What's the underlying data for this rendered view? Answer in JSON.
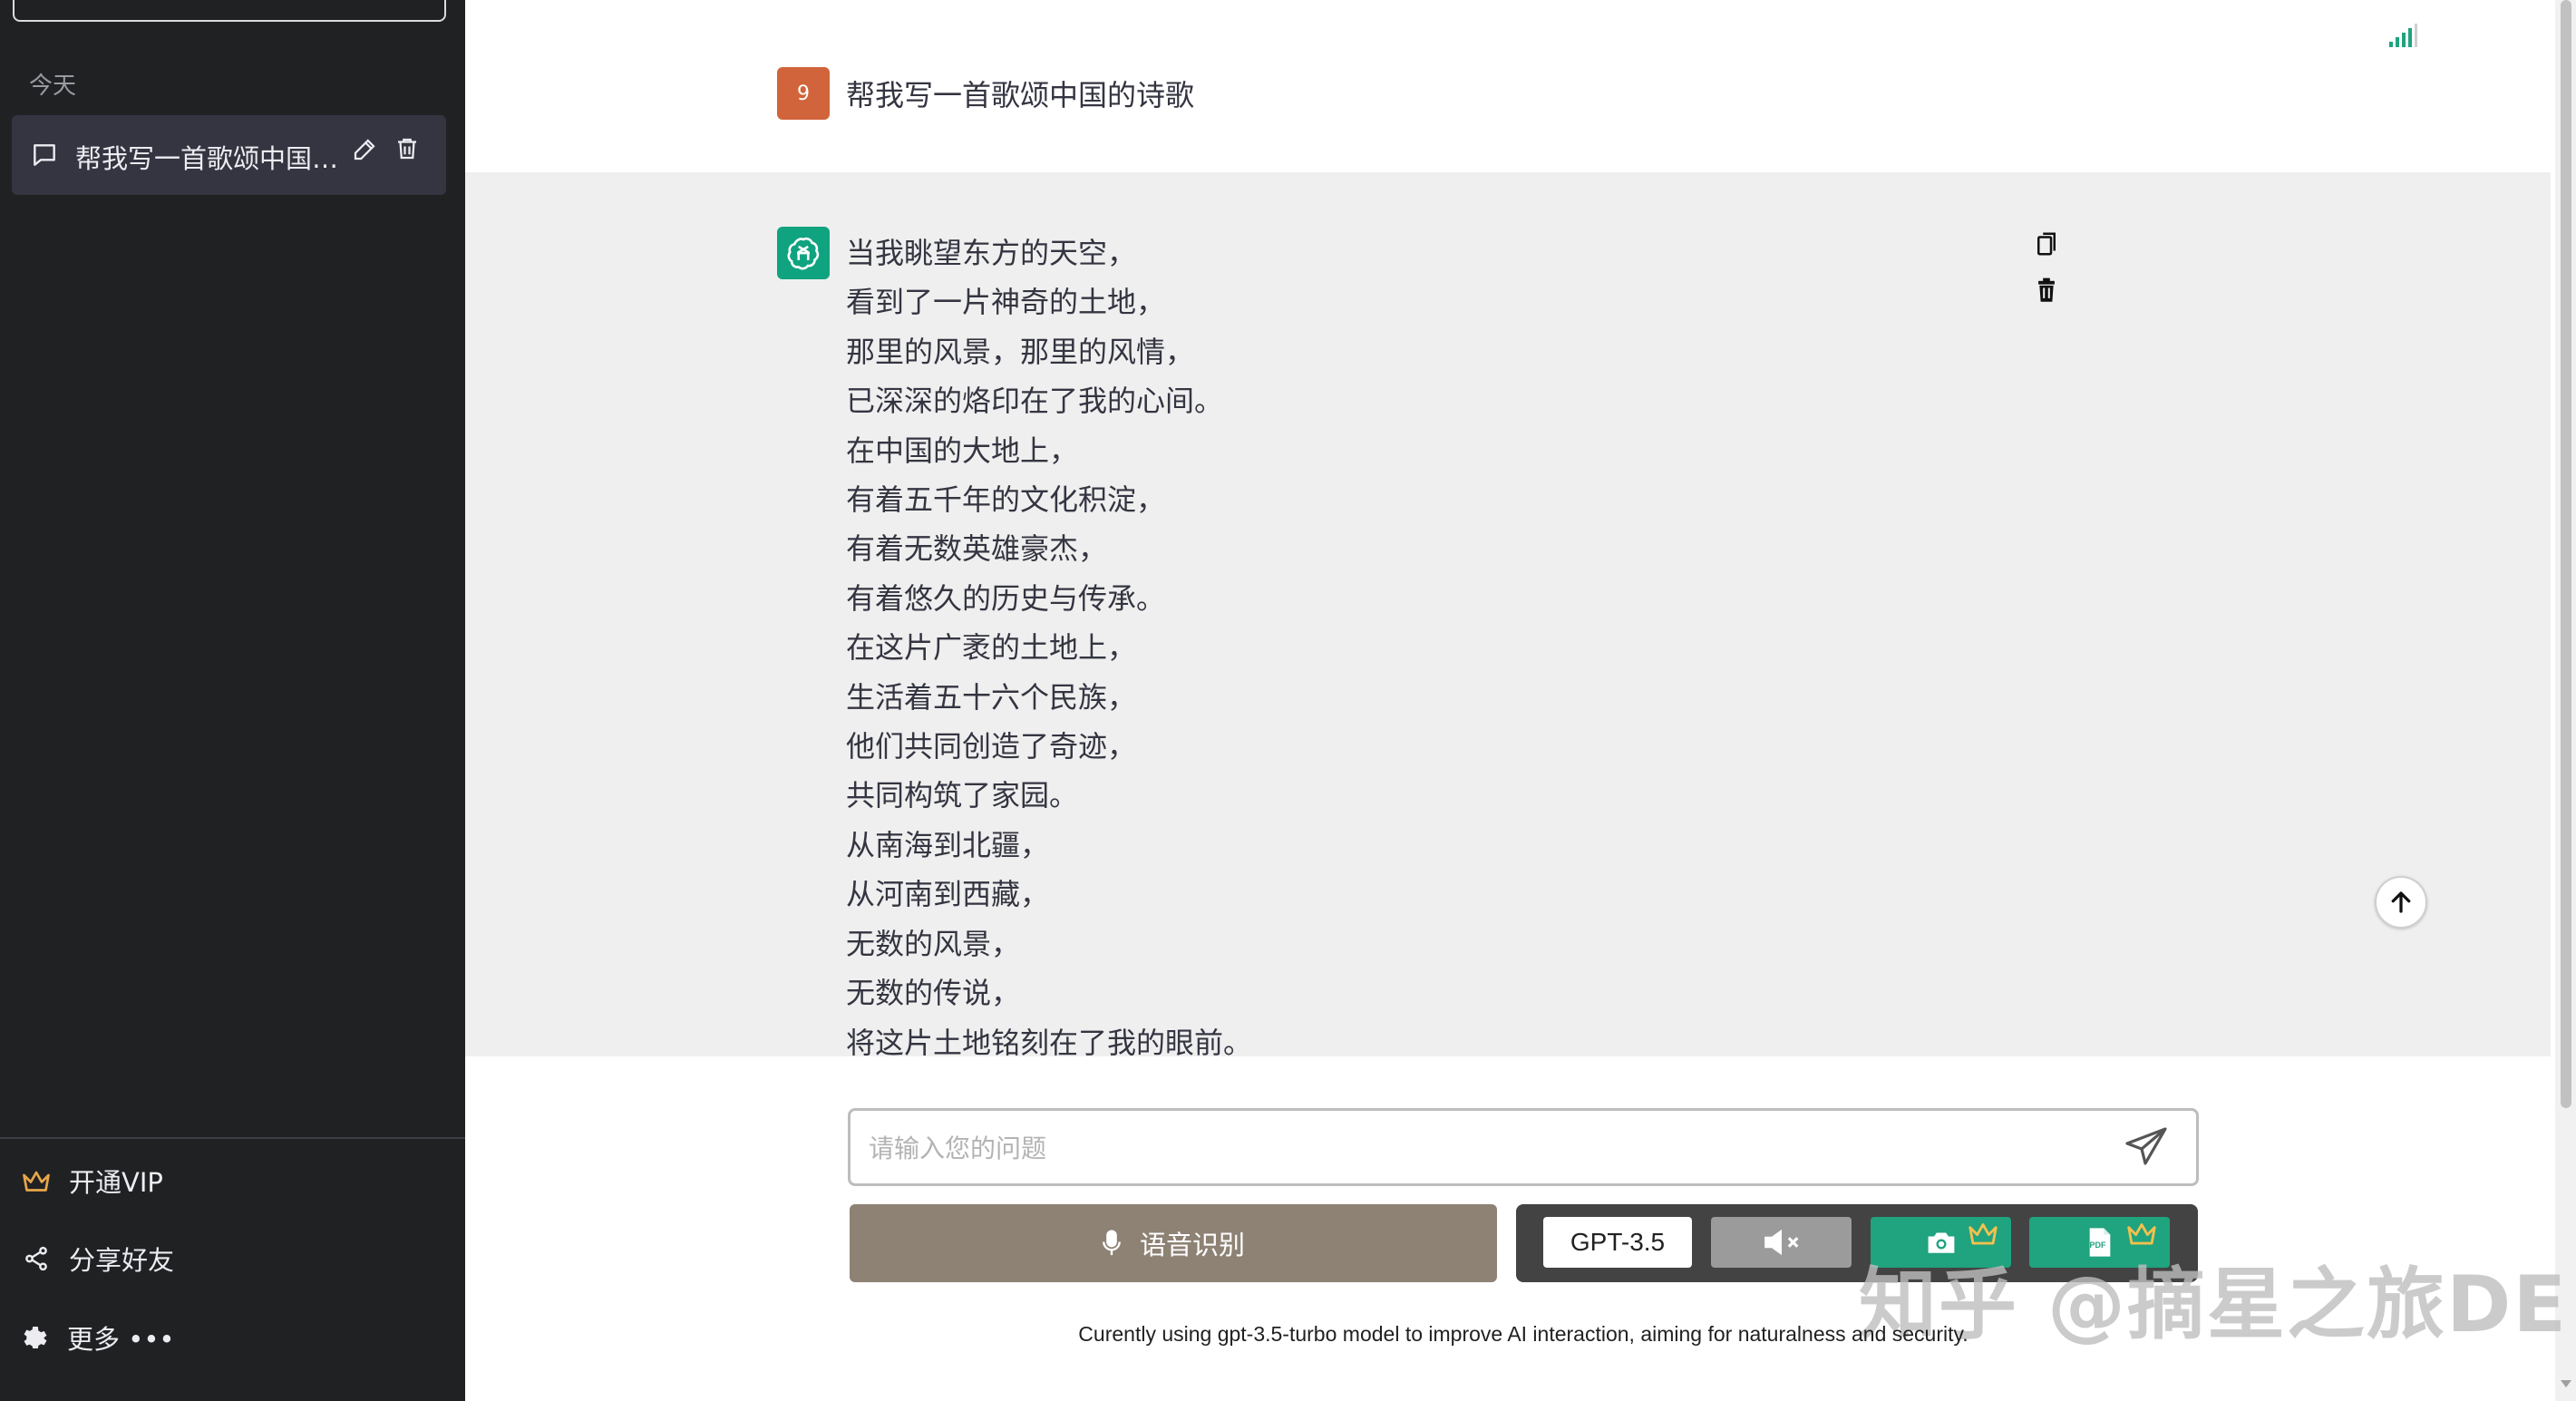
{
  "sidebar": {
    "section_label": "今天",
    "conversation_title": "帮我写一首歌颂中国的诗歌",
    "footer": {
      "vip_label": "开通VIP",
      "share_label": "分享好友",
      "more_label": "更多 •••"
    }
  },
  "chat": {
    "user_avatar_text": "9",
    "user_message": "帮我写一首歌颂中国的诗歌",
    "assistant_lines": [
      "当我眺望东方的天空，",
      "看到了一片神奇的土地，",
      "那里的风景，那里的风情，",
      "已深深的烙印在了我的心间。",
      "在中国的大地上，",
      "有着五千年的文化积淀，",
      "有着无数英雄豪杰，",
      "有着悠久的历史与传承。",
      "在这片广袤的土地上，",
      "生活着五十六个民族，",
      "他们共同创造了奇迹，",
      "共同构筑了家园。",
      "从南海到北疆，",
      "从河南到西藏，",
      "无数的风景，",
      "无数的传说，",
      "将这片土地铭刻在了我的眼前。"
    ]
  },
  "input": {
    "placeholder": "请输入您的问题"
  },
  "toolbar": {
    "voice_label": "语音识别",
    "model_label": "GPT-3.5",
    "camera_badge_text": "",
    "pdf_badge_text": "PDF"
  },
  "note": "Curently using gpt-3.5-turbo model to improve AI interaction, aiming for naturalness and security.",
  "watermark": "知乎 @摘星之旅DE",
  "icons": {
    "chat": "chat-bubble-icon",
    "edit": "pencil-icon",
    "delete": "trash-icon",
    "vip": "crown-icon",
    "share": "share-icon",
    "more": "gear-icon",
    "signal": "signal-icon",
    "copy": "copy-icon",
    "scroll_top": "arrow-up-icon",
    "send": "send-icon",
    "mic": "microphone-icon",
    "mute": "mute-icon",
    "camera": "camera-icon",
    "pdf": "pdf-icon"
  },
  "colors": {
    "sidebar_bg": "#202123",
    "active_item_bg": "#343541",
    "user_avatar": "#d1643a",
    "assistant_avatar": "#10a37f",
    "assistant_row_bg": "#efefef",
    "voice_button": "#8e8274",
    "toolbar_panel": "#434343",
    "accent_green": "#20a37f",
    "vip_crown": "#e8a64a"
  }
}
